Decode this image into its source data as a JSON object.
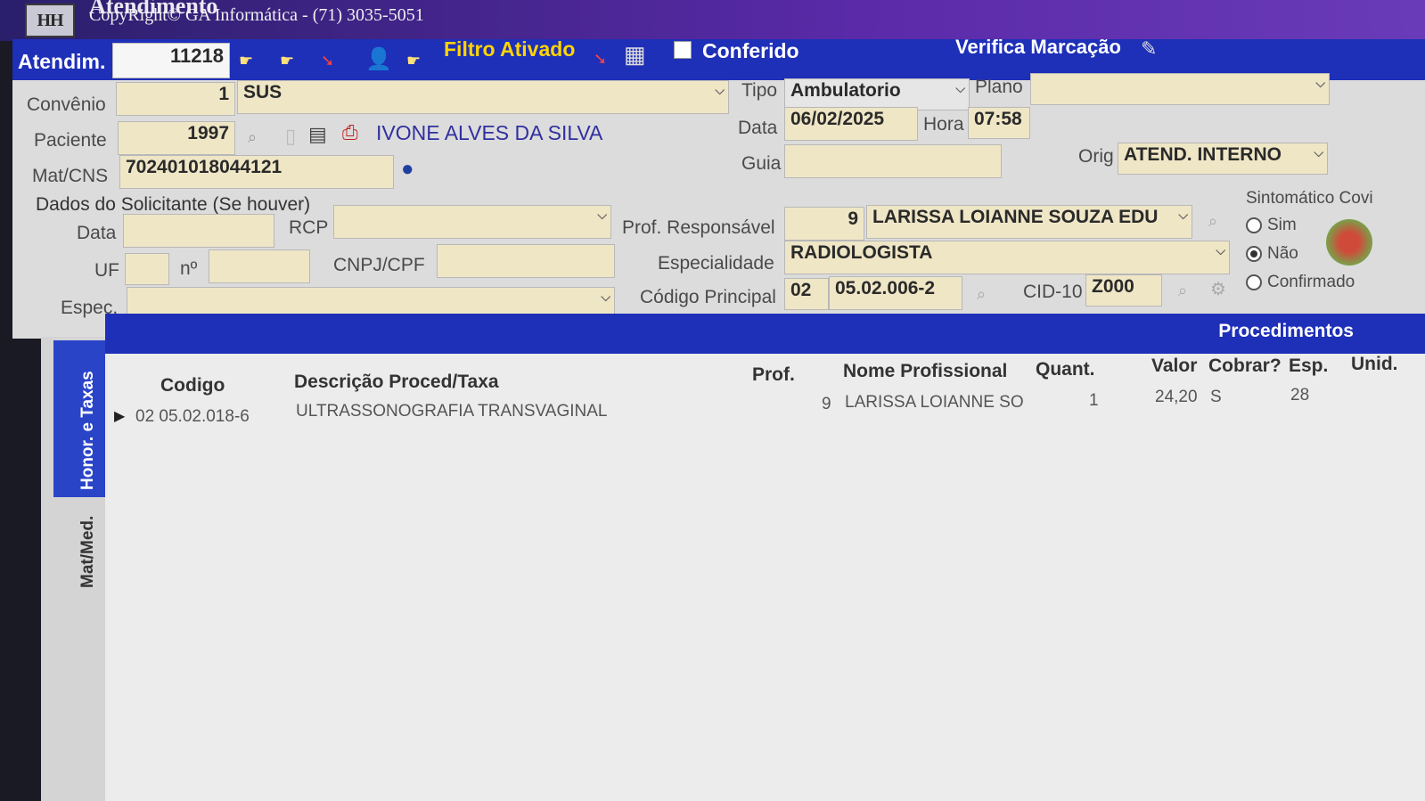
{
  "window": {
    "logo_text": "HH",
    "title": "Atendimento",
    "copyright": "CopyRight© GA Informática - (71) 3035-5051"
  },
  "toolbar": {
    "atendim_label": "Atendim.",
    "atendim_value": "11218",
    "filtro_label": "Filtro Ativado",
    "conferido_label": "Conferido",
    "verifica_label": "Verifica Marcação"
  },
  "form": {
    "convenio": {
      "label": "Convênio",
      "code": "1",
      "name": "SUS"
    },
    "tipo": {
      "label": "Tipo",
      "value": "Ambulatorio"
    },
    "plano": {
      "label": "Plano",
      "value": ""
    },
    "paciente": {
      "label": "Paciente",
      "code": "1997",
      "name": "IVONE ALVES DA SILVA"
    },
    "data": {
      "label": "Data",
      "value": "06/02/2025"
    },
    "hora": {
      "label": "Hora",
      "value": "07:58"
    },
    "matcns": {
      "label": "Mat/CNS",
      "value": "702401018044121"
    },
    "guia": {
      "label": "Guia",
      "value": ""
    },
    "orig": {
      "label": "Orig",
      "value": "ATEND. INTERNO"
    },
    "solicitante": {
      "title": "Dados do Solicitante (Se houver)",
      "data_label": "Data",
      "rcp_label": "RCP",
      "uf_label": "UF",
      "n_label": "nº",
      "cnpj_label": "CNPJ/CPF",
      "espec_label": "Espec."
    },
    "prof_resp": {
      "label": "Prof. Responsável",
      "code": "9",
      "name": "LARISSA LOIANNE SOUZA EDU"
    },
    "especialidade": {
      "label": "Especialidade",
      "value": "RADIOLOGISTA"
    },
    "codigo_principal": {
      "label": "Código Principal",
      "group": "02",
      "code": "05.02.006-2"
    },
    "cid10": {
      "label": "CID-10",
      "value": "Z000"
    },
    "sintomatico": {
      "title": "Sintomático Covi",
      "options": [
        "Sim",
        "Não",
        "Confirmado"
      ],
      "selected": "Não"
    }
  },
  "grid": {
    "band_title": "Procedimentos",
    "tabs": [
      "Honor. e Taxas",
      "Mat/Med."
    ],
    "active_tab": "Honor. e Taxas",
    "columns": [
      "Codigo",
      "Descrição Proced/Taxa",
      "Prof.",
      "Nome Profissional",
      "Quant.",
      "Valor",
      "Cobrar?",
      "Esp.",
      "Unid."
    ],
    "rows": [
      {
        "codigo": "02 05.02.018-6",
        "descricao": "ULTRASSONOGRAFIA TRANSVAGINAL",
        "prof": "9",
        "nome": "LARISSA LOIANNE SO",
        "quant": "1",
        "valor": "24,20",
        "cobrar": "S",
        "esp": "28",
        "unid": ""
      }
    ]
  },
  "colors": {
    "toolbar_blue": "#1e2fb8",
    "title_purple": "#5a2aa8",
    "field_bg": "#efe6c6",
    "filtro_yellow": "#ffd400"
  },
  "icons": [
    "hand-pointer-icon",
    "arrow-icon",
    "person-icon",
    "calculator-icon",
    "checkbox-icon",
    "pencil-icon",
    "globe-icon",
    "search-icon",
    "document-icon",
    "printer-icon",
    "covid-virus-icon"
  ]
}
